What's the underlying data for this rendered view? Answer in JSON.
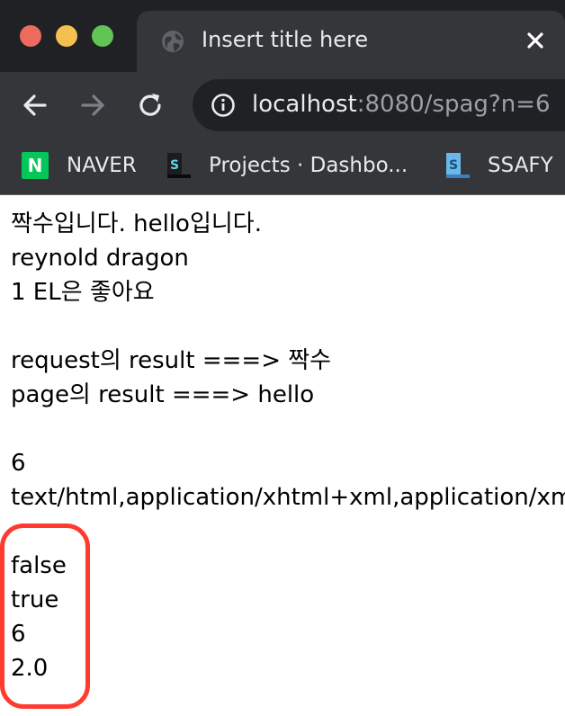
{
  "window": {
    "tab_title": "Insert title here",
    "url_host": "localhost",
    "url_rest": ":8080/spag?n=6"
  },
  "bookmarks": [
    {
      "label": "NAVER",
      "icon": "naver-icon"
    },
    {
      "label": "Projects · Dashbo...",
      "icon": "s-logo-icon"
    },
    {
      "label": "SSAFY",
      "icon": "s-logo-icon"
    }
  ],
  "content": {
    "lines": [
      "짝수입니다. hello입니다.",
      "reynold dragon",
      "1 EL은 좋아요",
      "",
      "request의 result ===> 짝수",
      "page의 result ===> hello",
      "",
      "6",
      "text/html,application/xhtml+xml,application/xml",
      "",
      "false",
      "true",
      "6",
      "2.0"
    ]
  },
  "colors": {
    "chrome_dark": "#202124",
    "chrome_tab": "#35363a",
    "highlight": "#ff3b30"
  }
}
